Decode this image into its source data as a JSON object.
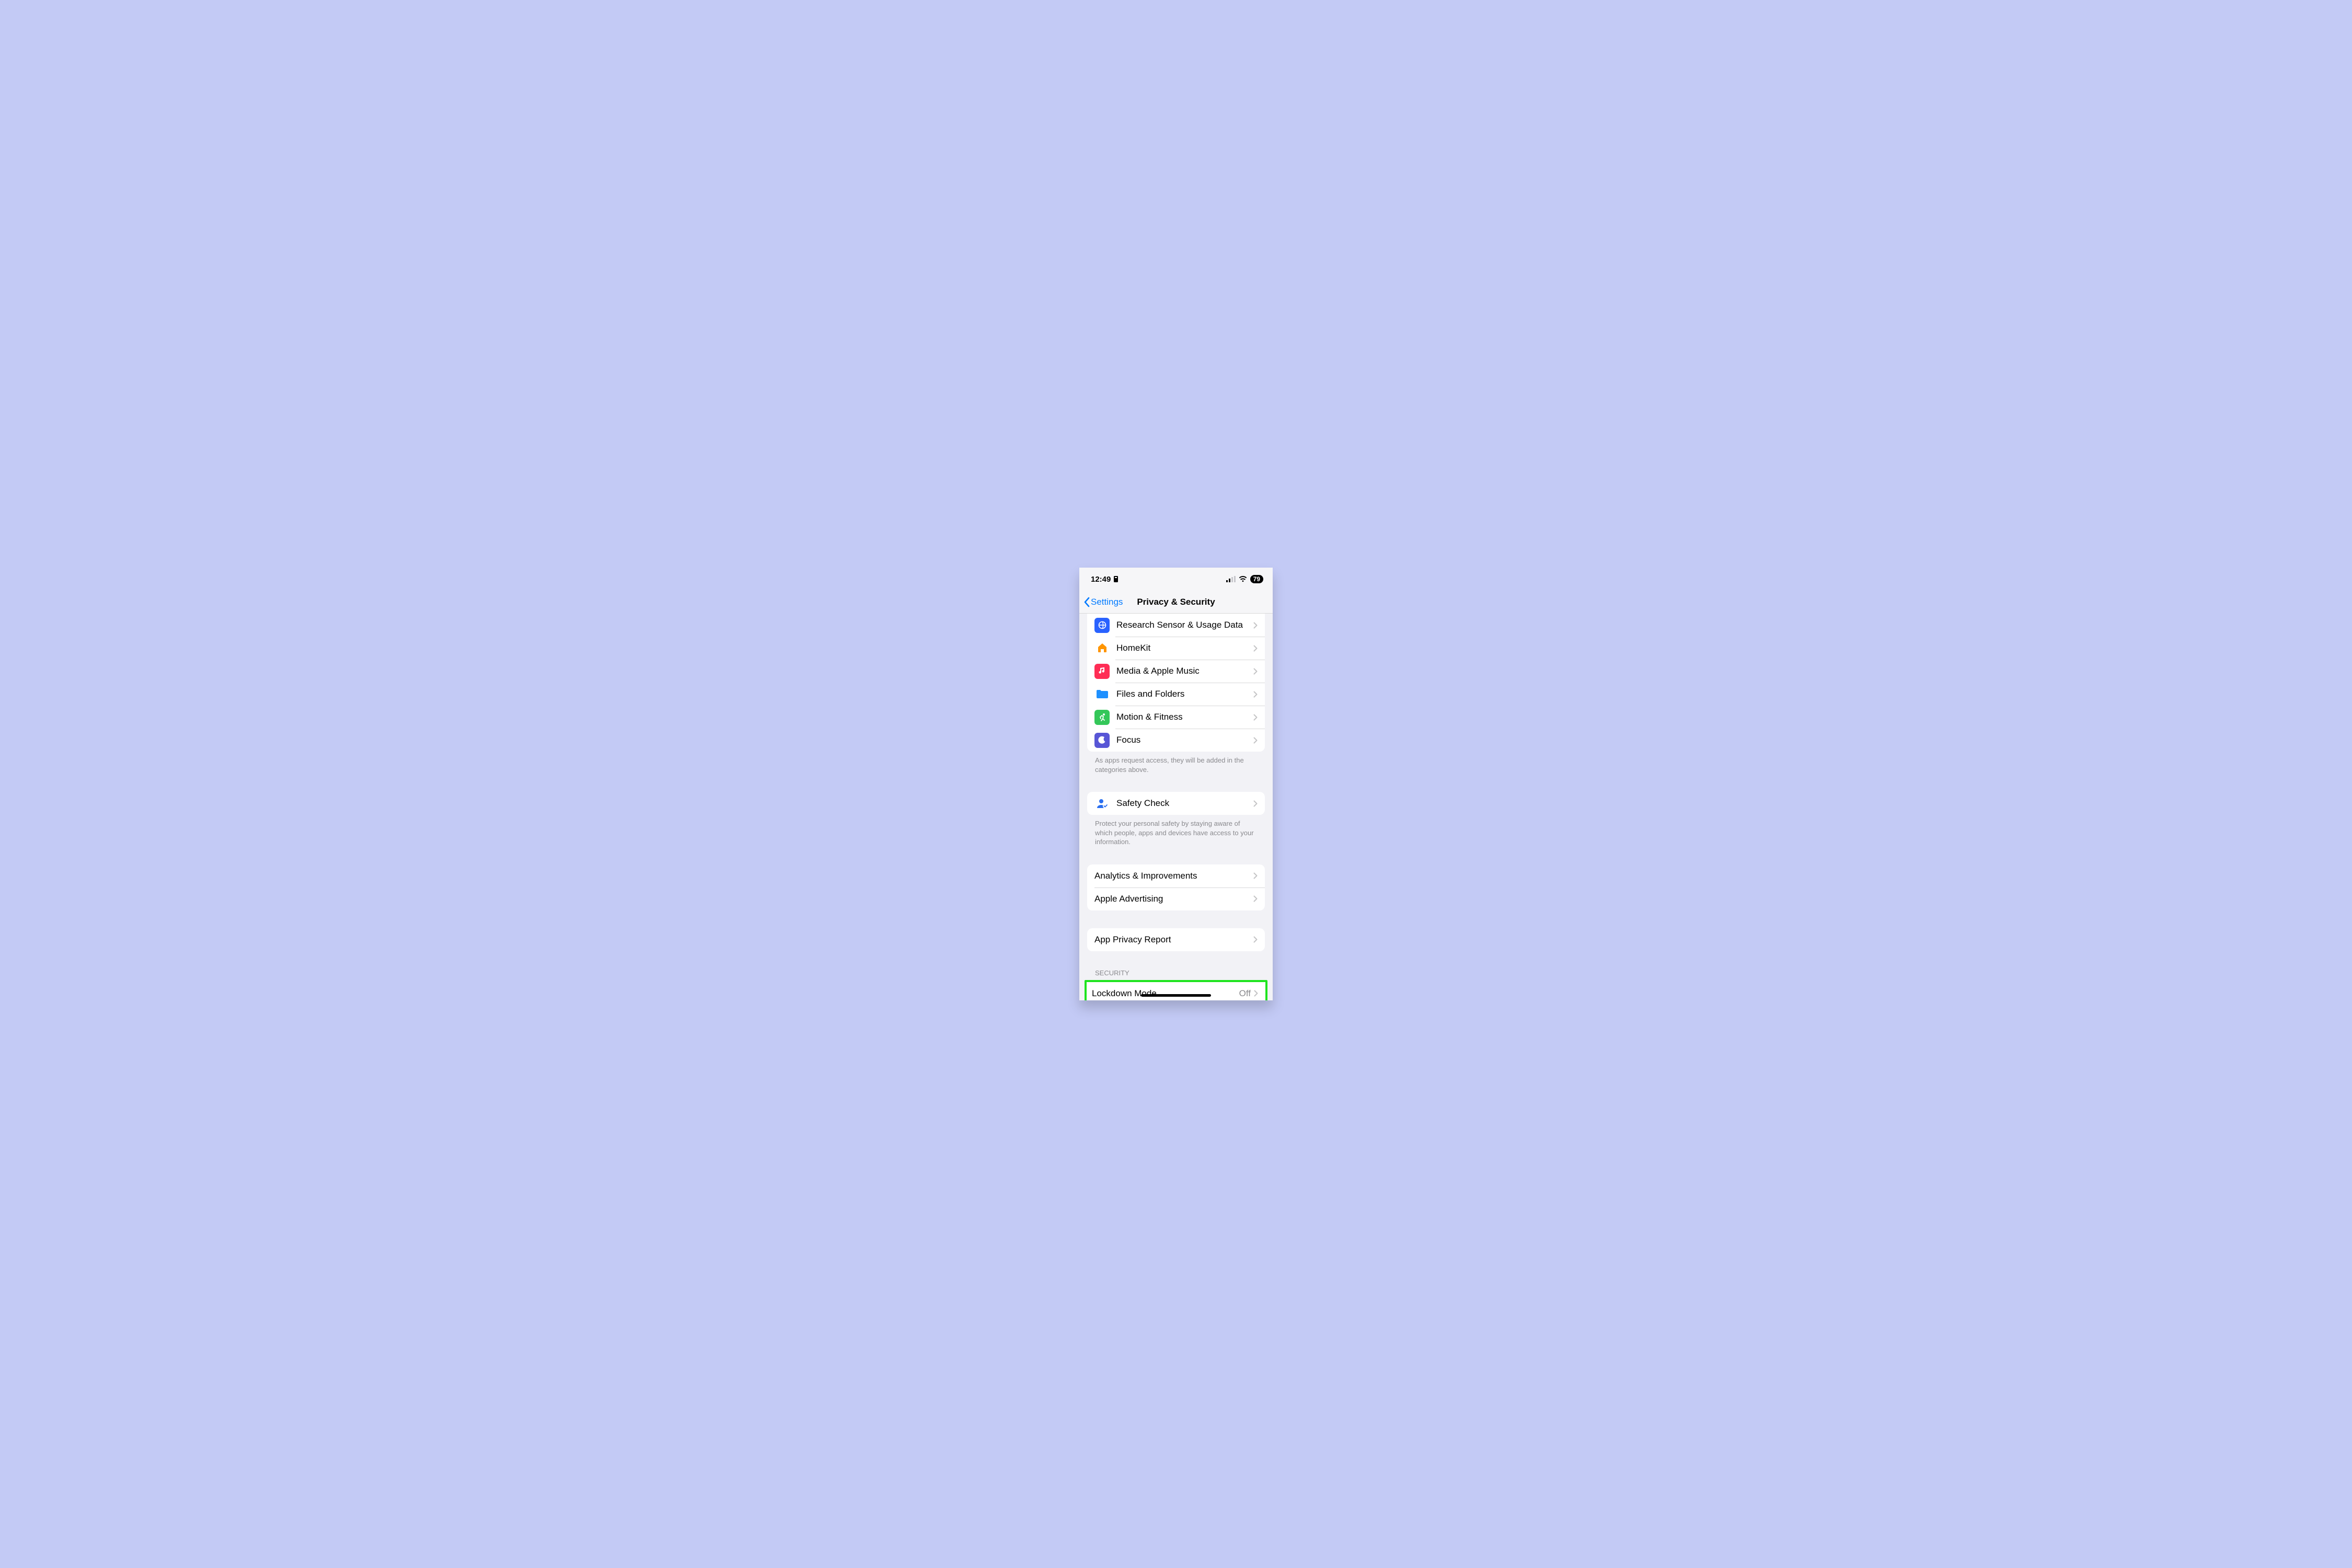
{
  "statusBar": {
    "time": "12:49",
    "battery": "79"
  },
  "nav": {
    "back": "Settings",
    "title": "Privacy & Security"
  },
  "groups": {
    "access": {
      "items": [
        {
          "label": "Research Sensor & Usage Data",
          "icon": "research",
          "color": "#2962ff"
        },
        {
          "label": "HomeKit",
          "icon": "home",
          "color": "#ff9500"
        },
        {
          "label": "Media & Apple Music",
          "icon": "music",
          "color": "#ff2d55"
        },
        {
          "label": "Files and Folders",
          "icon": "folder",
          "color": "#1e90ff"
        },
        {
          "label": "Motion & Fitness",
          "icon": "fitness",
          "color": "#34c759"
        },
        {
          "label": "Focus",
          "icon": "focus",
          "color": "#5856d6"
        }
      ],
      "footer": "As apps request access, they will be added in the categories above."
    },
    "safety": {
      "label": "Safety Check",
      "footer": "Protect your personal safety by staying aware of which people, apps and devices have access to your information."
    },
    "analytics": {
      "items": [
        {
          "label": "Analytics & Improvements"
        },
        {
          "label": "Apple Advertising"
        }
      ]
    },
    "appPrivacy": {
      "label": "App Privacy Report"
    },
    "security": {
      "header": "Security",
      "item": {
        "label": "Lockdown Mode",
        "value": "Off"
      }
    }
  }
}
